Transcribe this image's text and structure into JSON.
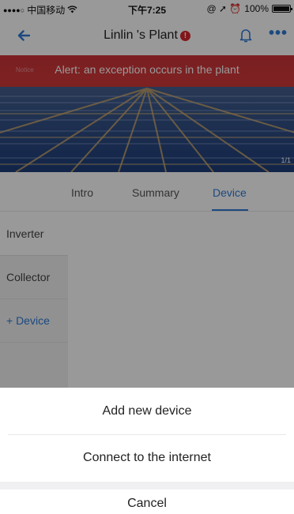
{
  "status_bar": {
    "signal": "●●●●○",
    "carrier": "中国移动",
    "wifi": "wifi-icon",
    "time": "下午7:25",
    "right_icons": "@ ➚ ⏰",
    "battery": "100%",
    "battery_level": 1.0
  },
  "nav": {
    "back_icon": "back-arrow-icon",
    "title": "Linlin 's Plant",
    "error_badge": "!",
    "bell_icon": "bell-icon",
    "more_icon": "more-icon",
    "accent": "#2f7bd6"
  },
  "alert": {
    "text": "Alert: an exception occurs in the plant",
    "label": "Notice"
  },
  "hero": {
    "page_indicator": "1/1"
  },
  "tabs": {
    "items": [
      "Intro",
      "Summary",
      "Device"
    ],
    "active": "Device"
  },
  "device_menu": {
    "items": [
      "Inverter",
      "Collector",
      "+ Device"
    ]
  },
  "action_sheet": {
    "options": [
      "Add new device",
      "Connect to the internet"
    ],
    "cancel": "Cancel"
  }
}
